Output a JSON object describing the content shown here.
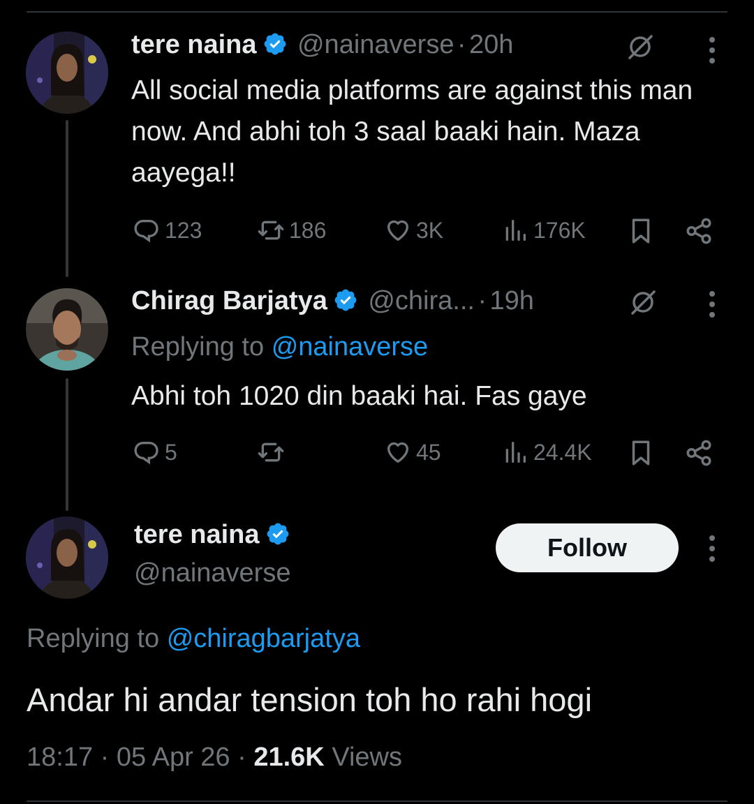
{
  "colors": {
    "background": "#000000",
    "text": "#e7e9ea",
    "muted": "#71767b",
    "link": "#1d9bf0",
    "verified": "#1d9bf0",
    "divider": "#2f3336"
  },
  "tweet1": {
    "name": "tere naina",
    "handle": "@nainaverse",
    "separator": "·",
    "time": "20h",
    "grok_icon": "slashed-circle-icon",
    "text": "All social media platforms are against this man now. And abhi toh 3 saal baaki hain. Maza aayega!!",
    "stats": {
      "replies": "123",
      "reposts": "186",
      "likes": "3K",
      "views": "176K"
    }
  },
  "tweet2": {
    "name": "Chirag Barjatya",
    "handle": "@chira...",
    "separator": "·",
    "time": "19h",
    "replying_prefix": "Replying to",
    "replying_to": "@nainaverse",
    "text": "Abhi toh 1020 din baaki hai. Fas gaye",
    "stats": {
      "replies": "5",
      "reposts": "",
      "likes": "45",
      "views": "24.4K"
    }
  },
  "main_tweet": {
    "name": "tere naina",
    "handle": "@nainaverse",
    "follow_label": "Follow",
    "replying_prefix": "Replying to",
    "replying_to": "@chiragbarjatya",
    "text": "Andar hi andar tension toh ho rahi hogi",
    "time": "18:17",
    "separator": "·",
    "date": "05 Apr 26",
    "views_count": "21.6K",
    "views_label": "Views"
  }
}
